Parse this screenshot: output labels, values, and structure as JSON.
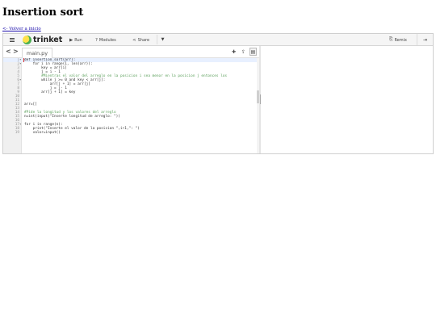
{
  "page": {
    "title": "Insertion sort",
    "back_link": "<- Volver a inicio"
  },
  "toolbar": {
    "brand": "trinket",
    "run_label": "Run",
    "modules_label": "Modules",
    "share_label": "Share",
    "remix_label": "Remix",
    "icons": {
      "menu": "hamburger-icon",
      "run": "play-icon",
      "modules": "question-icon",
      "share": "share-icon",
      "dropdown": "chevron-down-icon",
      "remix": "remix-icon",
      "login": "login-icon"
    }
  },
  "editor": {
    "file_tab": "main.py",
    "lines": [
      {
        "n": "1",
        "fold": "▾",
        "text": "def insertion_sort(arr):",
        "kind": "code"
      },
      {
        "n": "2",
        "fold": "▾",
        "text": "    for i in range(1, len(arr)):",
        "kind": "code"
      },
      {
        "n": "3",
        "fold": "",
        "text": "        key = arr[i]",
        "kind": "code"
      },
      {
        "n": "4",
        "fold": "",
        "text": "        j = i - 1",
        "kind": "code"
      },
      {
        "n": "5",
        "fold": "",
        "text": "        #Mientras el valor del arreglo en la posicion i sea menor en la posicion j entonces los",
        "kind": "comment"
      },
      {
        "n": "6",
        "fold": "▾",
        "text": "        while j >= 0 and key < arr[j]:",
        "kind": "code"
      },
      {
        "n": "7",
        "fold": "",
        "text": "            arr[j + 1] = arr[j]",
        "kind": "code"
      },
      {
        "n": "8",
        "fold": "",
        "text": "            j = j- 1",
        "kind": "code"
      },
      {
        "n": "9",
        "fold": "",
        "text": "        arr[j + 1] = key",
        "kind": "code"
      },
      {
        "n": "10",
        "fold": "",
        "text": "",
        "kind": "code"
      },
      {
        "n": "11",
        "fold": "",
        "text": "",
        "kind": "code"
      },
      {
        "n": "12",
        "fold": "",
        "text": "arr=[]",
        "kind": "code"
      },
      {
        "n": "13",
        "fold": "",
        "text": "",
        "kind": "code"
      },
      {
        "n": "14",
        "fold": "",
        "text": "#Pide la longitud y los valores del arreglo",
        "kind": "comment"
      },
      {
        "n": "15",
        "fold": "",
        "text": "n=int(input(\"Inserte longitud de arreglo: \"))",
        "kind": "code"
      },
      {
        "n": "16",
        "fold": "",
        "text": "",
        "kind": "code"
      },
      {
        "n": "17",
        "fold": "▾",
        "text": "for i in range(n):",
        "kind": "code"
      },
      {
        "n": "18",
        "fold": "",
        "text": "    print(\"Inserte el valor de la posicion \",i+1,\": \")",
        "kind": "code"
      },
      {
        "n": "19",
        "fold": "",
        "text": "    valor=input()",
        "kind": "code"
      }
    ]
  }
}
